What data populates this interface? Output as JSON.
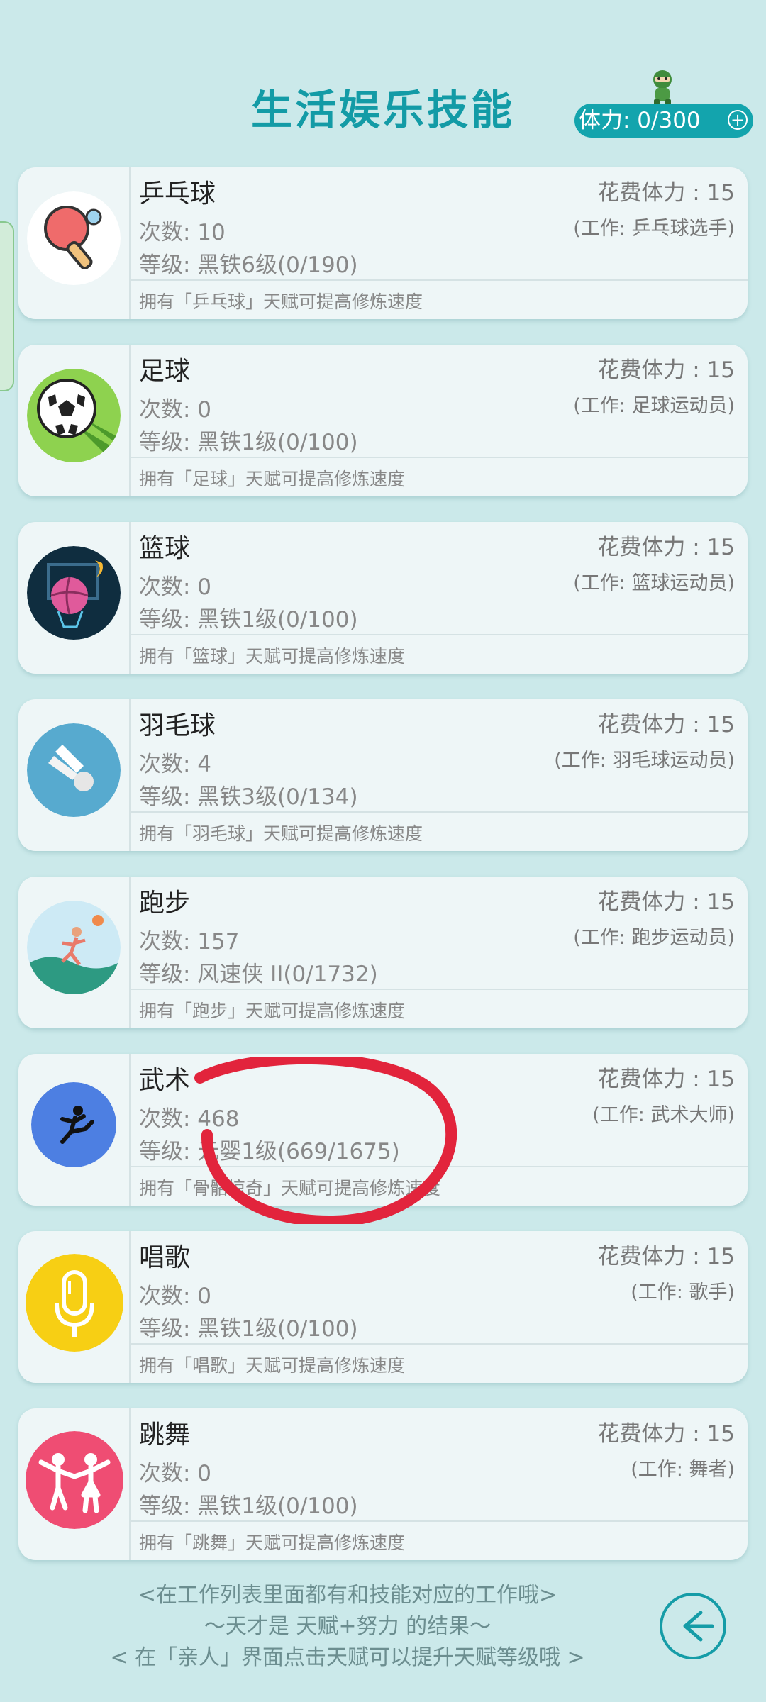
{
  "header": {
    "title": "生活娱乐技能",
    "stamina": "体力: 0/300",
    "stamina_plus": "+"
  },
  "cards": [
    {
      "name": "乒乓球",
      "cost": "花费体力 : 15",
      "job": "(工作: 乒乓球选手)",
      "count": "次数: 10",
      "level": "等级: 黑铁6级(0/190)",
      "talent": "拥有「乒乓球」天赋可提高修炼速度",
      "icon": "ping-pong-icon"
    },
    {
      "name": "足球",
      "cost": "花费体力 : 15",
      "job": "(工作: 足球运动员)",
      "count": "次数: 0",
      "level": "等级: 黑铁1级(0/100)",
      "talent": "拥有「足球」天赋可提高修炼速度",
      "icon": "soccer-ball-icon"
    },
    {
      "name": "篮球",
      "cost": "花费体力 : 15",
      "job": "(工作: 篮球运动员)",
      "count": "次数: 0",
      "level": "等级: 黑铁1级(0/100)",
      "talent": "拥有「篮球」天赋可提高修炼速度",
      "icon": "basketball-icon"
    },
    {
      "name": "羽毛球",
      "cost": "花费体力 : 15",
      "job": "(工作: 羽毛球运动员)",
      "count": "次数: 4",
      "level": "等级: 黑铁3级(0/134)",
      "talent": "拥有「羽毛球」天赋可提高修炼速度",
      "icon": "shuttlecock-icon"
    },
    {
      "name": "跑步",
      "cost": "花费体力 : 15",
      "job": "(工作: 跑步运动员)",
      "count": "次数: 157",
      "level": "等级: 风速侠 II(0/1732)",
      "talent": "拥有「跑步」天赋可提高修炼速度",
      "icon": "runner-icon"
    },
    {
      "name": "武术",
      "cost": "花费体力 : 15",
      "job": "(工作: 武术大师)",
      "count": "次数: 468",
      "level": "等级: 元婴1级(669/1675)",
      "talent": "拥有「骨骼惊奇」天赋可提高修炼速度",
      "icon": "martial-arts-icon"
    },
    {
      "name": "唱歌",
      "cost": "花费体力 : 15",
      "job": "(工作: 歌手)",
      "count": "次数: 0",
      "level": "等级: 黑铁1级(0/100)",
      "talent": "拥有「唱歌」天赋可提高修炼速度",
      "icon": "microphone-icon"
    },
    {
      "name": "跳舞",
      "cost": "花费体力 : 15",
      "job": "(工作: 舞者)",
      "count": "次数: 0",
      "level": "等级: 黑铁1级(0/100)",
      "talent": "拥有「跳舞」天赋可提高修炼速度",
      "icon": "dancers-icon"
    }
  ],
  "footer": {
    "line1": "<在工作列表里面都有和技能对应的工作哦>",
    "line2": "～天才是 天赋+努力 的结果～",
    "line3": "< 在「亲人」界面点击天赋可以提升天赋等级哦 >"
  },
  "colors": {
    "background": "#cbe9ea",
    "accent": "#139ba6",
    "annotation": "#e2243c"
  }
}
